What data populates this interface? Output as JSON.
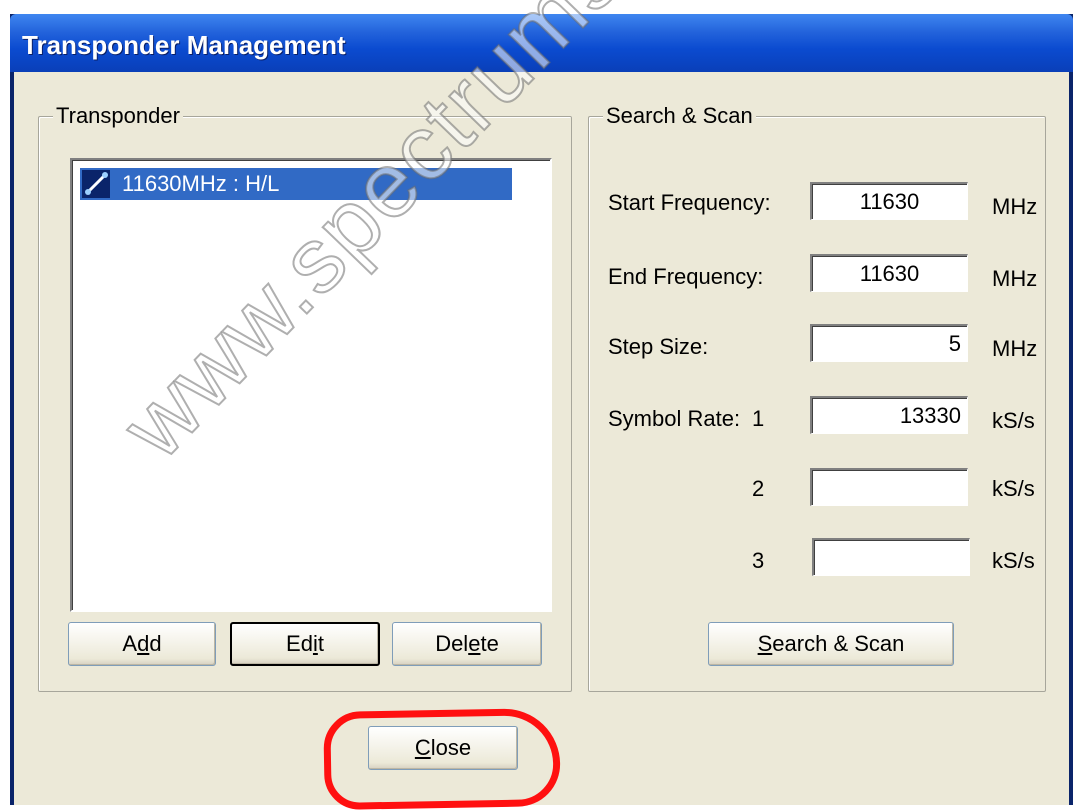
{
  "window": {
    "title": "Transponder Management"
  },
  "transponder": {
    "legend": "Transponder",
    "items": [
      {
        "label": "11630MHz : H/L",
        "selected": true
      }
    ],
    "buttons": {
      "add_prefix": "A",
      "add_accel": "d",
      "add_suffix": "d",
      "edit_prefix": "Ed",
      "edit_accel": "i",
      "edit_suffix": "t",
      "delete_prefix": "Del",
      "delete_accel": "e",
      "delete_suffix": "te"
    }
  },
  "search": {
    "legend": "Search & Scan",
    "start_label": "Start Frequency:",
    "start_value": "11630",
    "start_unit": "MHz",
    "end_label": "End Frequency:",
    "end_value": "11630",
    "end_unit": "MHz",
    "step_label": "Step Size:",
    "step_value": "5",
    "step_unit": "MHz",
    "symbol_label": "Symbol Rate:",
    "symbol_rates": [
      {
        "index": "1",
        "value": "13330",
        "unit": "kS/s"
      },
      {
        "index": "2",
        "value": "",
        "unit": "kS/s"
      },
      {
        "index": "3",
        "value": "",
        "unit": "kS/s"
      }
    ],
    "button_accel": "S",
    "button_suffix": "earch & Scan"
  },
  "footer": {
    "close_accel": "C",
    "close_suffix": "lose"
  },
  "watermark": "www.spectrumsat.net",
  "colors": {
    "titlebar": "#0a4bd0",
    "selection": "#316ac5",
    "face": "#ece9d8",
    "annotation": "#ff1010"
  }
}
